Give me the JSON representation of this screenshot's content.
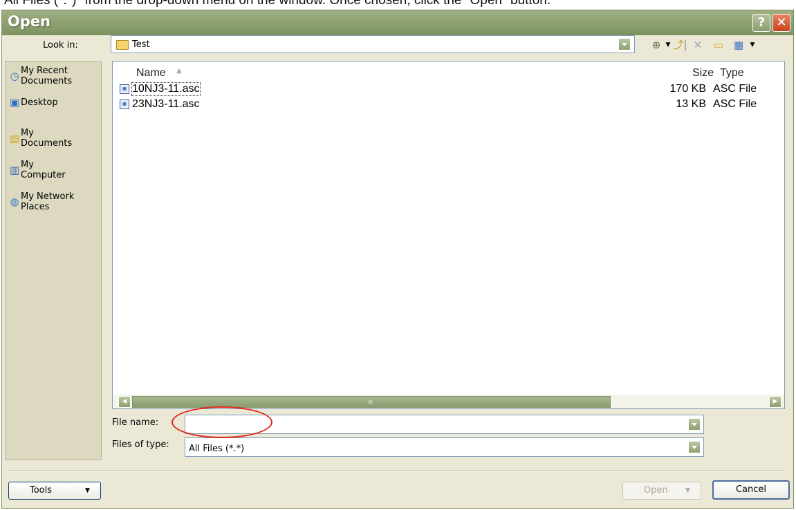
{
  "caption": "All Files (*.*)\" from the drop-down menu on the window. Once chosen, click the \"Open\" button.",
  "window": {
    "title": "Open",
    "help_button": "?",
    "close_button": "✕"
  },
  "look_in": {
    "label": "Look in:",
    "value": "Test"
  },
  "toolbar": {
    "back_icon": "⊕",
    "up_icon": "⤴",
    "delete_icon": "✕",
    "new_folder_icon": "▭",
    "views_icon": "▦",
    "dropdown_glyph": "▼"
  },
  "places": [
    {
      "label": "My Recent\nDocuments",
      "icon": "recent-documents-icon"
    },
    {
      "label": "Desktop",
      "icon": "desktop-icon"
    },
    {
      "label": "My\nDocuments",
      "icon": "my-documents-icon"
    },
    {
      "label": "My\nComputer",
      "icon": "my-computer-icon"
    },
    {
      "label": "My Network\nPlaces",
      "icon": "network-places-icon"
    }
  ],
  "file_list": {
    "columns": {
      "name": "Name",
      "size": "Size",
      "type": "Type"
    },
    "sort_indicator": "▲",
    "rows": [
      {
        "name": "10NJ3-11.asc",
        "size": "170 KB",
        "type": "ASC File"
      },
      {
        "name": "23NJ3-11.asc",
        "size": "13 KB",
        "type": "ASC File"
      }
    ],
    "scroll_grip": "III"
  },
  "file_name": {
    "label": "File name:",
    "value": ""
  },
  "files_of_type": {
    "label": "Files of type:",
    "value": "All Files (*.*)"
  },
  "buttons": {
    "tools": "Tools",
    "open": "Open",
    "cancel": "Cancel",
    "menu_arrow": "▼"
  },
  "colors": {
    "title_bar": "#8a9c6c",
    "window_bg": "#ebe9d6",
    "highlight_circle": "#e2231a"
  }
}
